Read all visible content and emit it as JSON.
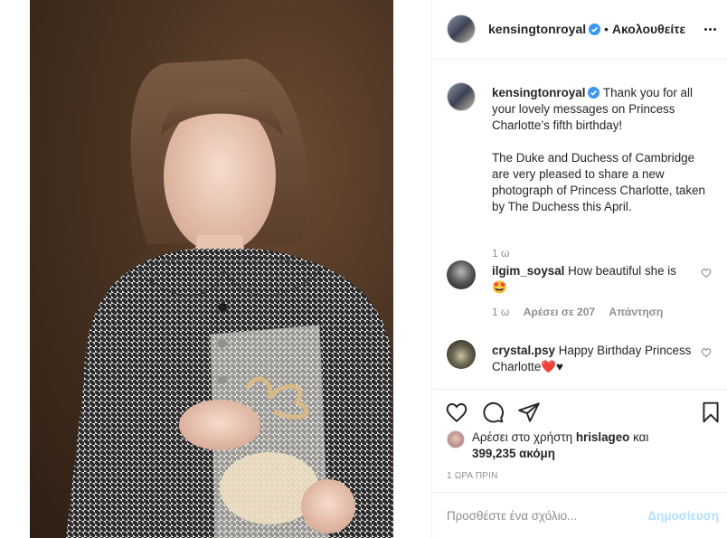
{
  "post": {
    "username": "kensingtonroyal",
    "follow_separator": "•",
    "follow_label": "Ακολουθείτε"
  },
  "caption": {
    "username": "kensingtonroyal",
    "text_1": "Thank you for all your lovely messages on Princess Charlotte’s fifth birthday!",
    "text_2": "The Duke and Duchess of Cambridge are very pleased to share a new photograph of Princess Charlotte, taken by The Duchess this April.",
    "time": "1 ω"
  },
  "comments": [
    {
      "username": "ilgim_soysal",
      "text": "How beautiful she is",
      "emoji": "🤩",
      "time": "1 ω",
      "likes": "Αρέσει σε 207",
      "reply": "Απάντηση"
    },
    {
      "username": "crystal.psy",
      "text": "Happy Birthday Princess Charlotte",
      "emoji": "❤️♥"
    }
  ],
  "likes": {
    "prefix": "Αρέσει στο χρήστη",
    "user": "hrislageo",
    "middle": "και",
    "count": "399,235 ακόμη"
  },
  "post_time": "1 ΩΡΑ ΠΡΙΝ",
  "add_comment": {
    "placeholder": "Προσθέστε ένα σχόλιο...",
    "post_label": "Δημοσίευση"
  },
  "colors": {
    "verified": "#3897f0",
    "text": "#262626",
    "muted": "#8e8e8e",
    "post_button_disabled": "#b2dffc"
  }
}
